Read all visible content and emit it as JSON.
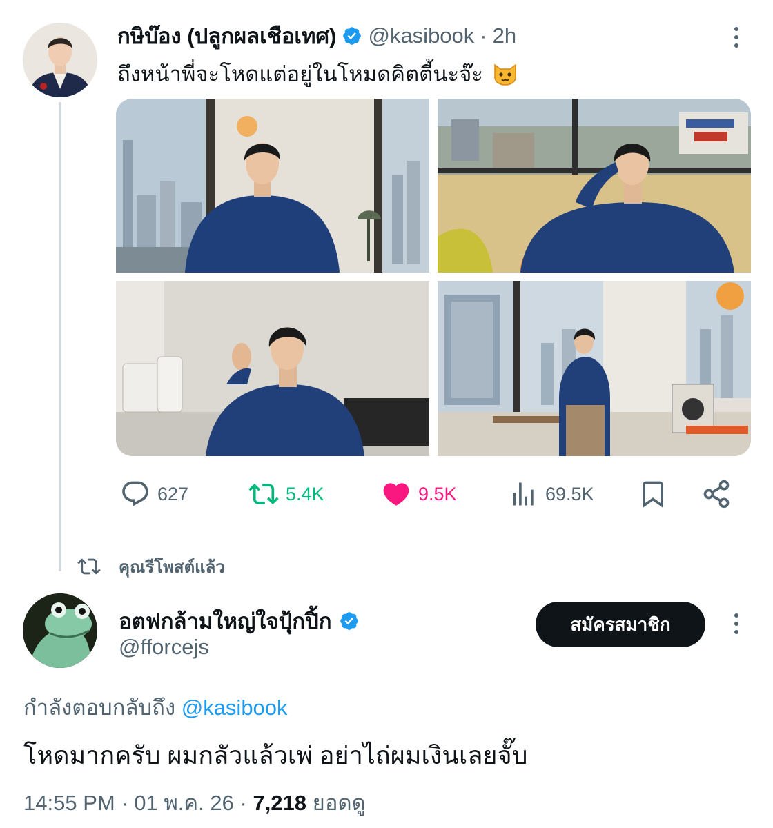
{
  "main_tweet": {
    "display_name": "กษิบ๊อง (ปลูกผลเชือเทศ)",
    "handle": "@kasibook",
    "separator": "·",
    "time_ago": "2h",
    "text": "ถึงหน้าพี่จะโหดแต่อยู่ในโหมดคิตตี้นะจ๊ะ",
    "emoji": "cat-face-emoji",
    "photos": [
      "photo-1",
      "photo-2",
      "photo-3",
      "photo-4"
    ],
    "stats": {
      "replies": "627",
      "reposts": "5.4K",
      "likes": "9.5K",
      "views": "69.5K"
    },
    "liked": true,
    "reposted": true
  },
  "repost_notice": "คุณรีโพสต์แล้ว",
  "reply_tweet": {
    "display_name": "อตฟกล้ามใหญ่ใจปุ้กปิ้ก",
    "handle": "@fforcejs",
    "subscribe_label": "สมัครสมาชิก",
    "replying_prefix": "กำลังตอบกลับถึง",
    "replying_to": "@kasibook",
    "text": "โหดมากครับ ผมกลัวแล้วเพ่ อย่าไถ่ผมเงินเลยจั๊บ",
    "time": "14:55 PM",
    "date": "01 พ.ค. 26",
    "views_count": "7,218",
    "views_label": "ยอดดู"
  },
  "colors": {
    "text": "#0f1419",
    "secondary": "#536471",
    "link": "#1d9bf0",
    "repost_green": "#00ba7c",
    "like_pink": "#f91880",
    "verified_blue": "#1d9bf0",
    "thread_line": "#cfd9de"
  }
}
